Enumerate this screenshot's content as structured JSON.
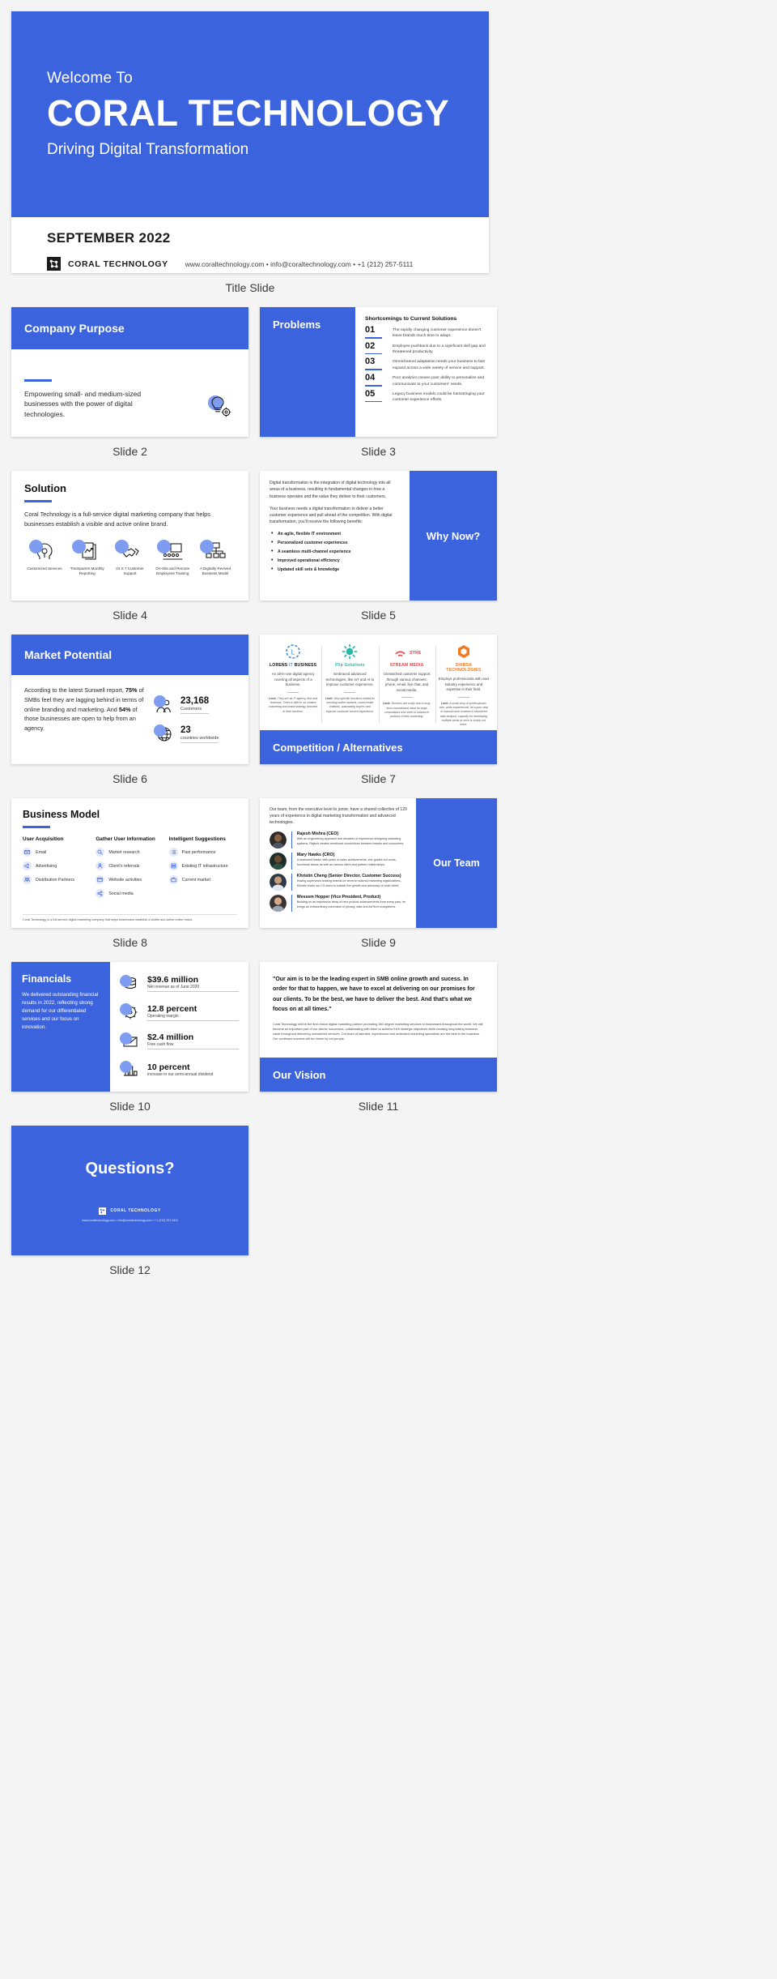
{
  "brand": {
    "name": "CORAL TECHNOLOGY",
    "accent": "#3b63dd",
    "accent_light": "#7e9cf0",
    "contact": "www.coraltechnology.com • info@coraltechnology.com • +1 (212) 257-5111"
  },
  "captions": {
    "title": "Title Slide",
    "s2": "Slide 2",
    "s3": "Slide 3",
    "s4": "Slide 4",
    "s5": "Slide 5",
    "s6": "Slide 6",
    "s7": "Slide 7",
    "s8": "Slide 8",
    "s9": "Slide 9",
    "s10": "Slide 10",
    "s11": "Slide 11",
    "s12": "Slide 12"
  },
  "title_slide": {
    "welcome": "Welcome To",
    "company": "CORAL TECHNOLOGY",
    "tagline": "Driving Digital Transformation",
    "date": "SEPTEMBER 2022",
    "brand_name": "CORAL TECHNOLOGY",
    "contact": "www.coraltechnology.com • info@coraltechnology.com • +1 (212) 257-5111"
  },
  "slide2": {
    "header": "Company Purpose",
    "body": "Empowering small- and medium-sized businesses with the power of digital technologies.",
    "icon": "lightbulb-gear-icon"
  },
  "slide3": {
    "header": "Problems",
    "list_title": "Shortcomings to Current Solutions",
    "items": [
      {
        "num": "01",
        "text": "The rapidly changing customer experience doesn't leave brands much time to adapt."
      },
      {
        "num": "02",
        "text": "Employee pushback due to a significant skill gap and threatened productivity."
      },
      {
        "num": "03",
        "text": "Omnichannel adaptation needs your business to fast expand across a wide variety of service and support."
      },
      {
        "num": "04",
        "text": "Poor analytics means poor ability to personalize and communicate to your customers' needs."
      },
      {
        "num": "05",
        "text": "Legacy business models could be hamstringing your customer experience efforts."
      }
    ]
  },
  "slide4": {
    "header": "Solution",
    "lead": "Coral Technology is a full-service digital marketing company that helps businesses establish a visible and active online brand.",
    "features": [
      {
        "label": "Customized Services",
        "icon": "headset-icon"
      },
      {
        "label": "Transparent Monthly Reporting",
        "icon": "report-chart-icon"
      },
      {
        "label": "24 X 7 Customer Support",
        "icon": "handshake-icon"
      },
      {
        "label": "On-Site and Remote Employees Training",
        "icon": "training-board-icon"
      },
      {
        "label": "A Digitally Revived Business Model",
        "icon": "org-chart-icon"
      }
    ]
  },
  "slide5": {
    "header": "Why Now?",
    "paragraph1": "Digital transformation is the integration of digital technology into all areas of a business, resulting in fundamental changes in how a business operates and the value they deliver to their customers.",
    "paragraph2": "Your business needs a digital transformation to deliver a better customer experience and pull ahead of the competition. With digital transformation, you'll receive the following benefits:",
    "bullets": [
      "An agile, flexible IT environment",
      "Personalized customer experiences",
      "A seamless multi-channel experience",
      "Improved operational efficiency",
      "Updated skill sets & knowledge"
    ]
  },
  "slide6": {
    "header": "Market Potential",
    "body_pre": "According to the latest Sunwell report, ",
    "body_b1": "75%",
    "body_mid": " of SMBs feel they are lagging behind in terms of online branding and marketing. And ",
    "body_b2": "54%",
    "body_post": " of those businesses are open to help from an agency.",
    "stats": [
      {
        "value": "23,168",
        "label": "Customers",
        "icon": "people-icon"
      },
      {
        "value": "23",
        "label": "countries worldwide",
        "icon": "globe-icon"
      }
    ]
  },
  "slide7": {
    "header": "Competition / Alternatives",
    "competitors": [
      {
        "name": "LORENS IT BUSINESS",
        "name_plain": "LORENS",
        "name_accent": "IT",
        "name_tail": "BUSINESS",
        "desc": "An all-in-one digital agency covering all aspects of a business.",
        "limit_label": "Limit:",
        "limit": "They are an IT agency, first and foremost. There is little to no content marketing and brand strategy included in their services.",
        "logo": "lorens-clock-logo"
      },
      {
        "name": "Flip Solutions",
        "desc": "Embraced advanced technologies, like IoT and AI to improve customer experience.",
        "limit_label": "Limit:",
        "limit": "Very specific functions related to boosting online markets, could create chatbots, automating buyers' and improve customer service experience.",
        "logo": "flip-sun-logo"
      },
      {
        "name": "STREAM MEDIA",
        "desc": "Unmatched customer support through various channels: phone, email, live chat, and social media.",
        "limit_label": "Limit:",
        "limit": "Services are costly due to long-term commitment, ideal for large corporations who seek to outsource portions of their marketing.",
        "logo": "stream-media-logo"
      },
      {
        "name": "SHIBSA TECHNOLOGIES",
        "desc": "Employs professionals with vast industry experience and expertise in their field.",
        "limit_label": "Limit:",
        "limit": "A small shop of professionals who, while experienced, let a poor deal of manual work covered in structured data analysis, capacity for developing multiple areas at once is simply not there.",
        "logo": "shibsa-hex-logo"
      }
    ]
  },
  "slide8": {
    "header": "Business Model",
    "columns": [
      {
        "title": "User Acquisition",
        "items": [
          {
            "label": "Email",
            "icon": "envelope-icon"
          },
          {
            "label": "Advertising",
            "icon": "megaphone-icon"
          },
          {
            "label": "Distribution Partners",
            "icon": "partners-icon"
          }
        ]
      },
      {
        "title": "Gather User Information",
        "items": [
          {
            "label": "Market research",
            "icon": "magnifier-icon"
          },
          {
            "label": "Client's referrals",
            "icon": "user-icon"
          },
          {
            "label": "Website activities",
            "icon": "browser-icon"
          },
          {
            "label": "Social media",
            "icon": "share-icon"
          }
        ]
      },
      {
        "title": "Intelligent Suggestions",
        "items": [
          {
            "label": "Past performance",
            "icon": "list-icon"
          },
          {
            "label": "Existing IT infrastructure",
            "icon": "server-icon"
          },
          {
            "label": "Current market",
            "icon": "briefcase-icon"
          }
        ]
      }
    ],
    "footnote": "Coral Technology is a full-service digital marketing company that helps businesses establish a visible and active online brand."
  },
  "slide9": {
    "header": "Our Team",
    "intro": "Our team, from the executive level to junior, have a shared collective of 120 years of experience in digital marketing transformation and advanced technologies.",
    "members": [
      {
        "name": "Rajesh Mishra (CEO)",
        "desc": "With an engineering approach and decades of experience designing marketing systems, Rajesh creates emotional connections between brands and consumers."
      },
      {
        "name": "Mary Hawks (CRO)",
        "desc": "A seasoned leader with years of sales achievements, she guides our cross-functional teams as well as various client and partner relationships."
      },
      {
        "name": "Khristin Cheng (Senior Director, Customer Success)",
        "desc": "Having supervised leading brands for several national marketing organizations, Khristin leads our CS team to sustain the growth and advocacy of each client."
      },
      {
        "name": "Wessem Hopper (Vice President, Product)",
        "desc": "Building on an impressive array of new product advancements from every past, he brings an extraordinary command of privacy, data and AdTech ecosystems."
      }
    ]
  },
  "slide10": {
    "header": "Financials",
    "body": "We delivered outstanding financial results in 2022, reflecting strong demand for our differentiated services and our focus on innovation.",
    "stats": [
      {
        "value": "$39.6 million",
        "label": "Net revenue as of June 2020",
        "icon": "coins-icon"
      },
      {
        "value": "12.8 percent",
        "label": "Operating margin",
        "icon": "gauge-icon"
      },
      {
        "value": "$2.4 million",
        "label": "Free cash flow",
        "icon": "money-envelope-icon"
      },
      {
        "value": "10 percent",
        "label": "increase in our semi-annual dividend",
        "icon": "bar-chart-icon"
      }
    ]
  },
  "slide11": {
    "header": "Our Vision",
    "quote": "\"Our aim is to be the leading expert in SMB online growth and sucess. In order for that to happen, we have to excel at delivering on our promises for our clients. To be the best, we have to deliver the best. And that's what we focus on at all times.\"",
    "small": "Coral Technology will be the first choice digital marketing partner promoting 360 degree marketing services to businesses throughout the world. We will become an important part of our clients' successes, collaborating with them to achieve their strategic objectives while creating long lasting business value throughout delivering unmatched services. Our team of talented, experienced and motivated marketing specialists are the best in the business. Our continued success will be driven by our people."
  },
  "slide12": {
    "title": "Questions?",
    "brand_name": "CORAL TECHNOLOGY",
    "contact": "www.coraltechnology.com • info@coraltechnology.com • +1 (212) 257-5111"
  }
}
